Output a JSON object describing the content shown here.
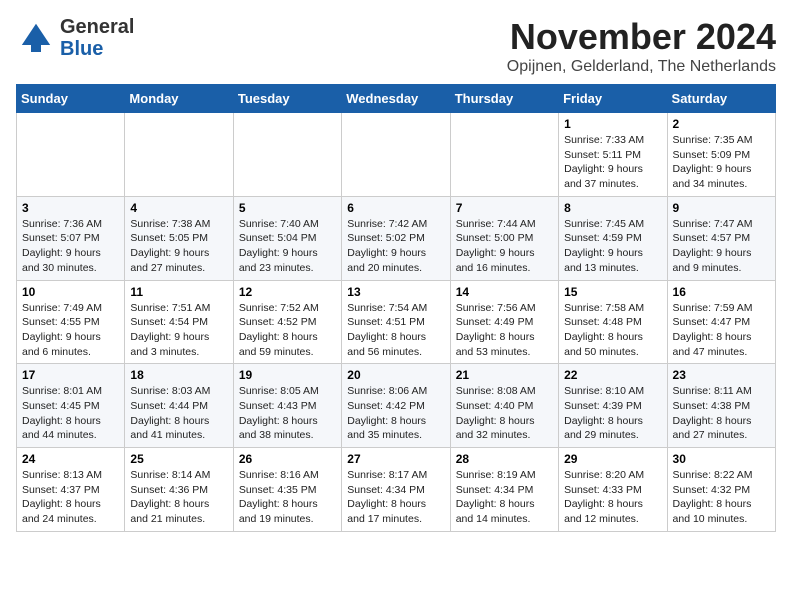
{
  "header": {
    "logo": {
      "general": "General",
      "blue": "Blue"
    },
    "title": "November 2024",
    "location": "Opijnen, Gelderland, The Netherlands"
  },
  "calendar": {
    "headers": [
      "Sunday",
      "Monday",
      "Tuesday",
      "Wednesday",
      "Thursday",
      "Friday",
      "Saturday"
    ],
    "weeks": [
      {
        "days": [
          {
            "date": "",
            "info": ""
          },
          {
            "date": "",
            "info": ""
          },
          {
            "date": "",
            "info": ""
          },
          {
            "date": "",
            "info": ""
          },
          {
            "date": "",
            "info": ""
          },
          {
            "date": "1",
            "info": "Sunrise: 7:33 AM\nSunset: 5:11 PM\nDaylight: 9 hours\nand 37 minutes."
          },
          {
            "date": "2",
            "info": "Sunrise: 7:35 AM\nSunset: 5:09 PM\nDaylight: 9 hours\nand 34 minutes."
          }
        ]
      },
      {
        "days": [
          {
            "date": "3",
            "info": "Sunrise: 7:36 AM\nSunset: 5:07 PM\nDaylight: 9 hours\nand 30 minutes."
          },
          {
            "date": "4",
            "info": "Sunrise: 7:38 AM\nSunset: 5:05 PM\nDaylight: 9 hours\nand 27 minutes."
          },
          {
            "date": "5",
            "info": "Sunrise: 7:40 AM\nSunset: 5:04 PM\nDaylight: 9 hours\nand 23 minutes."
          },
          {
            "date": "6",
            "info": "Sunrise: 7:42 AM\nSunset: 5:02 PM\nDaylight: 9 hours\nand 20 minutes."
          },
          {
            "date": "7",
            "info": "Sunrise: 7:44 AM\nSunset: 5:00 PM\nDaylight: 9 hours\nand 16 minutes."
          },
          {
            "date": "8",
            "info": "Sunrise: 7:45 AM\nSunset: 4:59 PM\nDaylight: 9 hours\nand 13 minutes."
          },
          {
            "date": "9",
            "info": "Sunrise: 7:47 AM\nSunset: 4:57 PM\nDaylight: 9 hours\nand 9 minutes."
          }
        ]
      },
      {
        "days": [
          {
            "date": "10",
            "info": "Sunrise: 7:49 AM\nSunset: 4:55 PM\nDaylight: 9 hours\nand 6 minutes."
          },
          {
            "date": "11",
            "info": "Sunrise: 7:51 AM\nSunset: 4:54 PM\nDaylight: 9 hours\nand 3 minutes."
          },
          {
            "date": "12",
            "info": "Sunrise: 7:52 AM\nSunset: 4:52 PM\nDaylight: 8 hours\nand 59 minutes."
          },
          {
            "date": "13",
            "info": "Sunrise: 7:54 AM\nSunset: 4:51 PM\nDaylight: 8 hours\nand 56 minutes."
          },
          {
            "date": "14",
            "info": "Sunrise: 7:56 AM\nSunset: 4:49 PM\nDaylight: 8 hours\nand 53 minutes."
          },
          {
            "date": "15",
            "info": "Sunrise: 7:58 AM\nSunset: 4:48 PM\nDaylight: 8 hours\nand 50 minutes."
          },
          {
            "date": "16",
            "info": "Sunrise: 7:59 AM\nSunset: 4:47 PM\nDaylight: 8 hours\nand 47 minutes."
          }
        ]
      },
      {
        "days": [
          {
            "date": "17",
            "info": "Sunrise: 8:01 AM\nSunset: 4:45 PM\nDaylight: 8 hours\nand 44 minutes."
          },
          {
            "date": "18",
            "info": "Sunrise: 8:03 AM\nSunset: 4:44 PM\nDaylight: 8 hours\nand 41 minutes."
          },
          {
            "date": "19",
            "info": "Sunrise: 8:05 AM\nSunset: 4:43 PM\nDaylight: 8 hours\nand 38 minutes."
          },
          {
            "date": "20",
            "info": "Sunrise: 8:06 AM\nSunset: 4:42 PM\nDaylight: 8 hours\nand 35 minutes."
          },
          {
            "date": "21",
            "info": "Sunrise: 8:08 AM\nSunset: 4:40 PM\nDaylight: 8 hours\nand 32 minutes."
          },
          {
            "date": "22",
            "info": "Sunrise: 8:10 AM\nSunset: 4:39 PM\nDaylight: 8 hours\nand 29 minutes."
          },
          {
            "date": "23",
            "info": "Sunrise: 8:11 AM\nSunset: 4:38 PM\nDaylight: 8 hours\nand 27 minutes."
          }
        ]
      },
      {
        "days": [
          {
            "date": "24",
            "info": "Sunrise: 8:13 AM\nSunset: 4:37 PM\nDaylight: 8 hours\nand 24 minutes."
          },
          {
            "date": "25",
            "info": "Sunrise: 8:14 AM\nSunset: 4:36 PM\nDaylight: 8 hours\nand 21 minutes."
          },
          {
            "date": "26",
            "info": "Sunrise: 8:16 AM\nSunset: 4:35 PM\nDaylight: 8 hours\nand 19 minutes."
          },
          {
            "date": "27",
            "info": "Sunrise: 8:17 AM\nSunset: 4:34 PM\nDaylight: 8 hours\nand 17 minutes."
          },
          {
            "date": "28",
            "info": "Sunrise: 8:19 AM\nSunset: 4:34 PM\nDaylight: 8 hours\nand 14 minutes."
          },
          {
            "date": "29",
            "info": "Sunrise: 8:20 AM\nSunset: 4:33 PM\nDaylight: 8 hours\nand 12 minutes."
          },
          {
            "date": "30",
            "info": "Sunrise: 8:22 AM\nSunset: 4:32 PM\nDaylight: 8 hours\nand 10 minutes."
          }
        ]
      }
    ]
  }
}
